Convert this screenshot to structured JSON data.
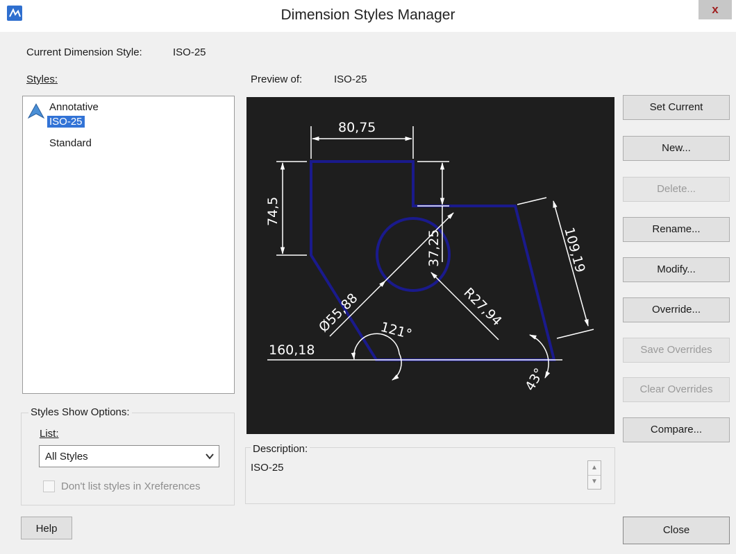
{
  "window": {
    "title": "Dimension Styles Manager",
    "close_label": "x"
  },
  "current_style": {
    "label": "Current Dimension Style:",
    "value": "ISO-25"
  },
  "styles": {
    "label": "Styles:",
    "items": [
      "Annotative",
      "ISO-25",
      "Standard"
    ],
    "selected": "ISO-25"
  },
  "show_options": {
    "group_label": "Styles Show Options:",
    "list_label": "List:",
    "list_value": "All Styles",
    "xref_checkbox_label": "Don't list styles in Xreferences",
    "xref_checked": false
  },
  "preview": {
    "label": "Preview of:",
    "value": "ISO-25",
    "dims": {
      "width": "80,75",
      "height": "74,5",
      "vertical_small": "37,25",
      "slanted": "109,19",
      "diameter": "Ø55,88",
      "radius": "R27,94",
      "angle_left": "121°",
      "baseline": "160,18",
      "angle_right": "43°"
    }
  },
  "buttons": {
    "set_current": "Set Current",
    "new": "New...",
    "delete": "Delete...",
    "rename": "Rename...",
    "modify": "Modify...",
    "override": "Override...",
    "save_overrides": "Save Overrides",
    "clear_overrides": "Clear Overrides",
    "compare": "Compare...",
    "help": "Help",
    "close": "Close"
  },
  "description": {
    "label": "Description:",
    "value": "ISO-25"
  },
  "colors": {
    "preview_bg": "#1e1e1e",
    "geometry": "#1a1a8c",
    "dimension": "#ffffff",
    "selection": "#3273d6"
  }
}
